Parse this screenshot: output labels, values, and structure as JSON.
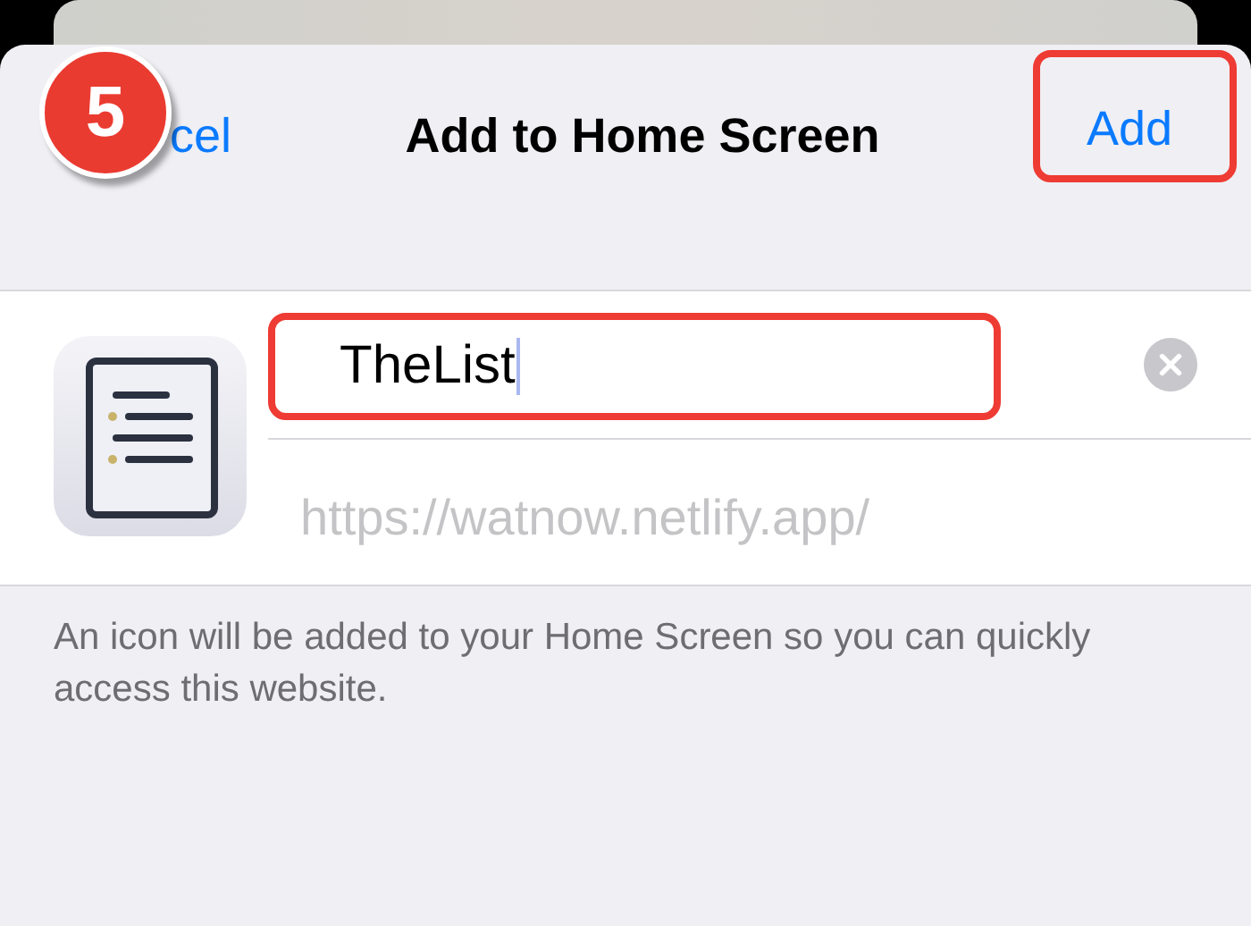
{
  "step_badge": {
    "number": "5"
  },
  "nav": {
    "cancel": "cel",
    "title": "Add to Home Screen",
    "add": {
      "label": "Add",
      "highlighted": true
    }
  },
  "name_field": {
    "value": "TheList",
    "focused": true,
    "highlighted": true
  },
  "url": "https://watnow.netlify.app/",
  "footer": "An icon will be added to your Home Screen so you can quickly access this website."
}
